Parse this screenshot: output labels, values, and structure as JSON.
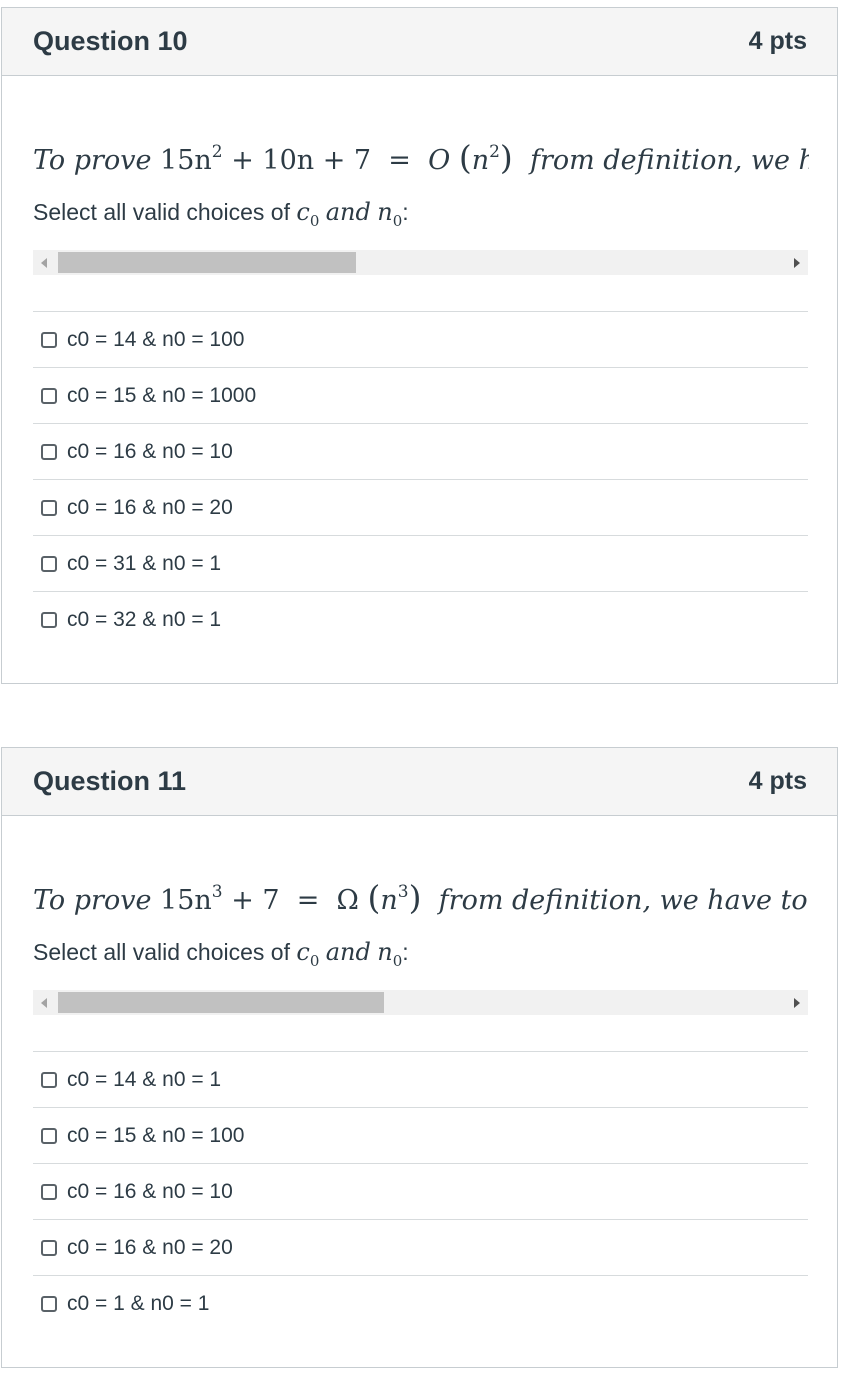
{
  "questions": [
    {
      "title": "Question 10",
      "points": "4 pts",
      "statement": {
        "prefix": "To prove",
        "expr_base": "15n",
        "expr_sup1": "2",
        "expr_rest": " + 10n + 7",
        "equals": "=",
        "bigo": "O",
        "paren_open": "(",
        "arg_base": "n",
        "arg_sup": "2",
        "paren_close": ")",
        "suffix": "from definition, we have t"
      },
      "select_prompt": "Select all valid choices of",
      "select_c": "c",
      "select_c_sub": "0",
      "select_and": "and",
      "select_n": "n",
      "select_n_sub": "0",
      "select_colon": ":",
      "scrollbar_position": 0.4,
      "answers": [
        "c0 = 14 & n0 = 100",
        "c0 = 15 & n0 = 1000",
        "c0 = 16 & n0 = 10",
        "c0 = 16 & n0 = 20",
        "c0 = 31 & n0 = 1",
        "c0 = 32 & n0 = 1"
      ]
    },
    {
      "title": "Question 11",
      "points": "4 pts",
      "statement": {
        "prefix": "To prove",
        "expr_base": "15n",
        "expr_sup1": "3",
        "expr_rest": " + 7",
        "equals": "=",
        "bigo": "Ω",
        "paren_open": "(",
        "arg_base": "n",
        "arg_sup": "3",
        "paren_close": ")",
        "suffix": "from definition, we have to shou"
      },
      "select_prompt": "Select all valid choices of",
      "select_c": "c",
      "select_c_sub": "0",
      "select_and": "and",
      "select_n": "n",
      "select_n_sub": "0",
      "select_colon": ":",
      "scrollbar_position": 0.44,
      "answers": [
        "c0 = 14 & n0 = 1",
        "c0 = 15 & n0 = 100",
        "c0 = 16 & n0 = 10",
        "c0 = 16 & n0 = 20",
        "c0 = 1 & n0 = 1"
      ]
    }
  ]
}
